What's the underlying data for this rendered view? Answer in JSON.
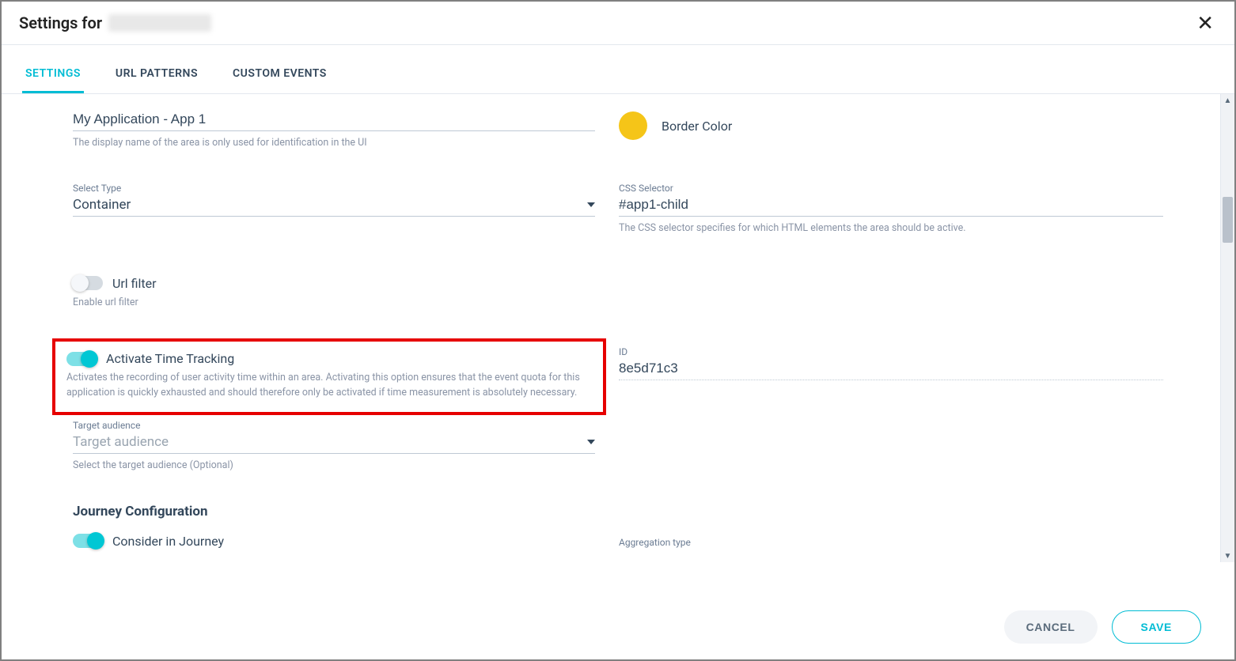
{
  "dialog": {
    "title_prefix": "Settings for ",
    "title_redacted": true
  },
  "tabs": [
    {
      "label": "SETTINGS",
      "active": true
    },
    {
      "label": "URL PATTERNS",
      "active": false
    },
    {
      "label": "CUSTOM EVENTS",
      "active": false
    }
  ],
  "form": {
    "display_name": {
      "value": "My Application - App 1",
      "help": "The display name of the area is only used for identification in the UI"
    },
    "border_color": {
      "label": "Border Color",
      "swatch": "#f5c518"
    },
    "select_type": {
      "label": "Select Type",
      "value": "Container"
    },
    "css_selector": {
      "label": "CSS Selector",
      "value": "#app1-child",
      "help": "The CSS selector specifies for which HTML elements the area should be active."
    },
    "url_filter": {
      "label": "Url filter",
      "help": "Enable url filter",
      "on": false
    },
    "time_tracking": {
      "label": "Activate Time Tracking",
      "on": true,
      "help": "Activates the recording of user activity time within an area. Activating this option ensures that the event quota for this application is quickly exhausted and should therefore only be activated if time measurement is absolutely necessary."
    },
    "id_field": {
      "label": "ID",
      "value": "8e5d71c3"
    },
    "target_audience": {
      "label": "Target audience",
      "placeholder": "Target audience",
      "help": "Select the target audience (Optional)"
    },
    "journey_heading": "Journey Configuration",
    "consider_journey": {
      "label": "Consider in Journey",
      "on": true
    },
    "aggregation_type": {
      "label": "Aggregation type"
    }
  },
  "footer": {
    "cancel": "CANCEL",
    "save": "SAVE"
  }
}
